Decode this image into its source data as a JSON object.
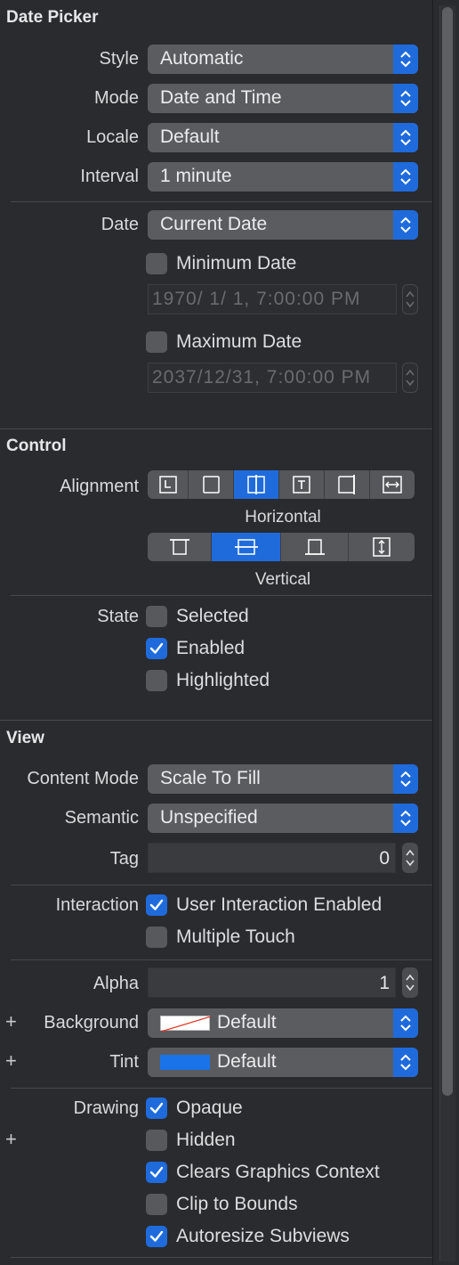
{
  "date_picker": {
    "title": "Date Picker",
    "style": {
      "label": "Style",
      "value": "Automatic"
    },
    "mode": {
      "label": "Mode",
      "value": "Date and Time"
    },
    "locale": {
      "label": "Locale",
      "value": "Default"
    },
    "interval": {
      "label": "Interval",
      "value": "1 minute"
    },
    "date": {
      "label": "Date",
      "value": "Current Date"
    },
    "minimum_date": {
      "label": "Minimum Date",
      "checked": false,
      "value": "1970/  1/  1,   7:00:00 PM"
    },
    "maximum_date": {
      "label": "Maximum Date",
      "checked": false,
      "value": "2037/12/31,   7:00:00 PM"
    }
  },
  "control": {
    "title": "Control",
    "alignment_label": "Alignment",
    "horizontal_caption": "Horizontal",
    "vertical_caption": "Vertical",
    "horizontal_selected": "center",
    "vertical_selected": "center",
    "state_label": "State",
    "state": {
      "selected": {
        "label": "Selected",
        "checked": false
      },
      "enabled": {
        "label": "Enabled",
        "checked": true
      },
      "highlighted": {
        "label": "Highlighted",
        "checked": false
      }
    }
  },
  "view": {
    "title": "View",
    "content_mode": {
      "label": "Content Mode",
      "value": "Scale To Fill"
    },
    "semantic": {
      "label": "Semantic",
      "value": "Unspecified"
    },
    "tag": {
      "label": "Tag",
      "value": "0"
    },
    "interaction_label": "Interaction",
    "user_interaction": {
      "label": "User Interaction Enabled",
      "checked": true
    },
    "multiple_touch": {
      "label": "Multiple Touch",
      "checked": false
    },
    "alpha": {
      "label": "Alpha",
      "value": "1"
    },
    "background": {
      "label": "Background",
      "value": "Default",
      "plus": "+"
    },
    "tint": {
      "label": "Tint",
      "value": "Default",
      "plus": "+",
      "color": "#1a73e8"
    },
    "drawing_label": "Drawing",
    "drawing_plus": "+",
    "opaque": {
      "label": "Opaque",
      "checked": true
    },
    "hidden": {
      "label": "Hidden",
      "checked": false
    },
    "clears_graphics": {
      "label": "Clears Graphics Context",
      "checked": true
    },
    "clip_to_bounds": {
      "label": "Clip to Bounds",
      "checked": false
    },
    "autoresize": {
      "label": "Autoresize Subviews",
      "checked": true
    }
  },
  "colors": {
    "accent": "#1f6bdc",
    "panel": "#2a2b2f",
    "control": "#5b5c60"
  }
}
